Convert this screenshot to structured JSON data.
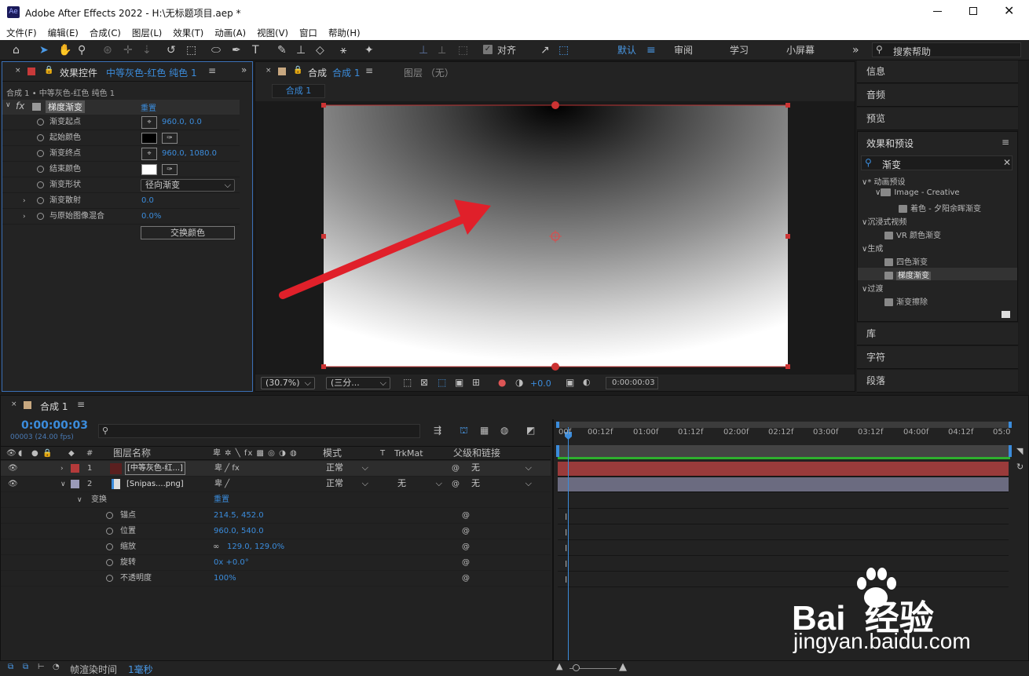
{
  "window": {
    "title": "Adobe After Effects 2022 - H:\\无标题项目.aep *",
    "app_icon": "Ae"
  },
  "menu": [
    "文件(F)",
    "编辑(E)",
    "合成(C)",
    "图层(L)",
    "效果(T)",
    "动画(A)",
    "视图(V)",
    "窗口",
    "帮助(H)"
  ],
  "toolbar": {
    "snap_label": "对齐",
    "workspaces": [
      "默认",
      "审阅",
      "学习",
      "小屏幕"
    ],
    "search_placeholder": "搜索帮助"
  },
  "effect_controls": {
    "tab_label": "效果控件",
    "tab_target": "中等灰色-红色 纯色 1",
    "breadcrumb": "合成 1 • 中等灰色-红色 纯色 1",
    "effect_name": "梯度渐变",
    "reset": "重置",
    "fx": "fx",
    "props": [
      {
        "label": "渐变起点",
        "value": "960.0, 0.0"
      },
      {
        "label": "起始颜色",
        "value": ""
      },
      {
        "label": "渐变终点",
        "value": "960.0, 1080.0"
      },
      {
        "label": "结束颜色",
        "value": ""
      },
      {
        "label": "渐变形状",
        "value": "径向渐变"
      },
      {
        "label": "渐变散射",
        "value": "0.0"
      },
      {
        "label": "与原始图像混合",
        "value": "0.0%"
      }
    ],
    "swap_button": "交换颜色",
    "start_color": "#000000",
    "end_color": "#ffffff"
  },
  "comp_panel": {
    "tab_label": "合成",
    "tab_name": "合成 1",
    "layer_tab": "图层 （无）",
    "sub_tab": "合成 1",
    "zoom": "(30.7%)",
    "resolution": "(三分...",
    "exposure": "+0.0",
    "timecode": "0:00:00:03"
  },
  "right_panels": {
    "info": "信息",
    "audio": "音频",
    "preview": "预览",
    "effects_presets": "效果和预设",
    "search_value": "渐变",
    "tree": [
      {
        "label": "* 动画预设",
        "level": 0
      },
      {
        "label": "Image - Creative",
        "level": 1
      },
      {
        "label": "着色 - 夕阳余晖渐变",
        "level": 2
      },
      {
        "label": "沉浸式视频",
        "level": 0
      },
      {
        "label": "VR 颜色渐变",
        "level": 1
      },
      {
        "label": "生成",
        "level": 0
      },
      {
        "label": "四色渐变",
        "level": 1
      },
      {
        "label": "梯度渐变",
        "level": 1
      },
      {
        "label": "过渡",
        "level": 0
      },
      {
        "label": "渐变擦除",
        "level": 1
      }
    ],
    "library": "库",
    "character": "字符",
    "paragraph": "段落"
  },
  "timeline": {
    "tab_label": "合成 1",
    "timecode": "0:00:00:03",
    "frames": "00003 (24.00 fps)",
    "headers": {
      "layer_name": "图层名称",
      "mode": "模式",
      "t": "T",
      "trkmat": "TrkMat",
      "parent": "父级和链接",
      "num": "#"
    },
    "layers": [
      {
        "num": "1",
        "name": "[中等灰色-红...]",
        "mode": "正常",
        "trkmat": "",
        "parent": "无",
        "color": "#b43a3a"
      },
      {
        "num": "2",
        "name": "[Snipas....png]",
        "mode": "正常",
        "trkmat": "无",
        "parent": "无",
        "color": "#9a9ab8"
      }
    ],
    "transform": {
      "label": "变换",
      "reset": "重置"
    },
    "props": [
      {
        "label": "锚点",
        "value": "214.5, 452.0"
      },
      {
        "label": "位置",
        "value": "960.0, 540.0"
      },
      {
        "label": "缩放",
        "value": "129.0, 129.0%"
      },
      {
        "label": "旋转",
        "value": "0x +0.0°"
      },
      {
        "label": "不透明度",
        "value": "100%"
      }
    ],
    "ruler": [
      "00f",
      "00:12f",
      "01:00f",
      "01:12f",
      "02:00f",
      "02:12f",
      "03:00f",
      "03:12f",
      "04:00f",
      "04:12f",
      "05:0"
    ],
    "footer_label": "帧渲染时间",
    "footer_value": "1毫秒"
  },
  "watermark": {
    "brand": "Bai  经验",
    "url": "jingyan.baidu.com"
  }
}
